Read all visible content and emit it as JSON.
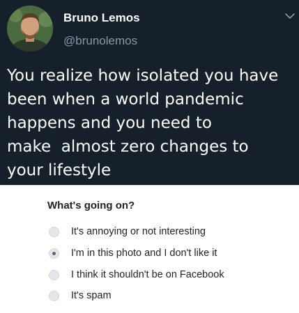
{
  "tweet": {
    "author_name": "Bruno Lemos",
    "author_handle": "@brunolemos",
    "text": "You realize how isolated you have\nbeen when a world pandemic\nhappens and you need to\nmake  almost zero changes to\nyour lifestyle",
    "menu_icon": "chevron-down-icon",
    "avatar_icon": "profile-photo"
  },
  "report_form": {
    "title": "What's going on?",
    "selected_index": 1,
    "options": [
      {
        "label": "It's annoying or not interesting",
        "checked": false
      },
      {
        "label": "I'm in this photo and I don't like it",
        "checked": true
      },
      {
        "label": "I think it shouldn't be on Facebook",
        "checked": false
      },
      {
        "label": "It's spam",
        "checked": false
      }
    ]
  },
  "colors": {
    "tweet_background": "#15202b",
    "handle": "#8899a6",
    "form_text": "#1d2129"
  }
}
